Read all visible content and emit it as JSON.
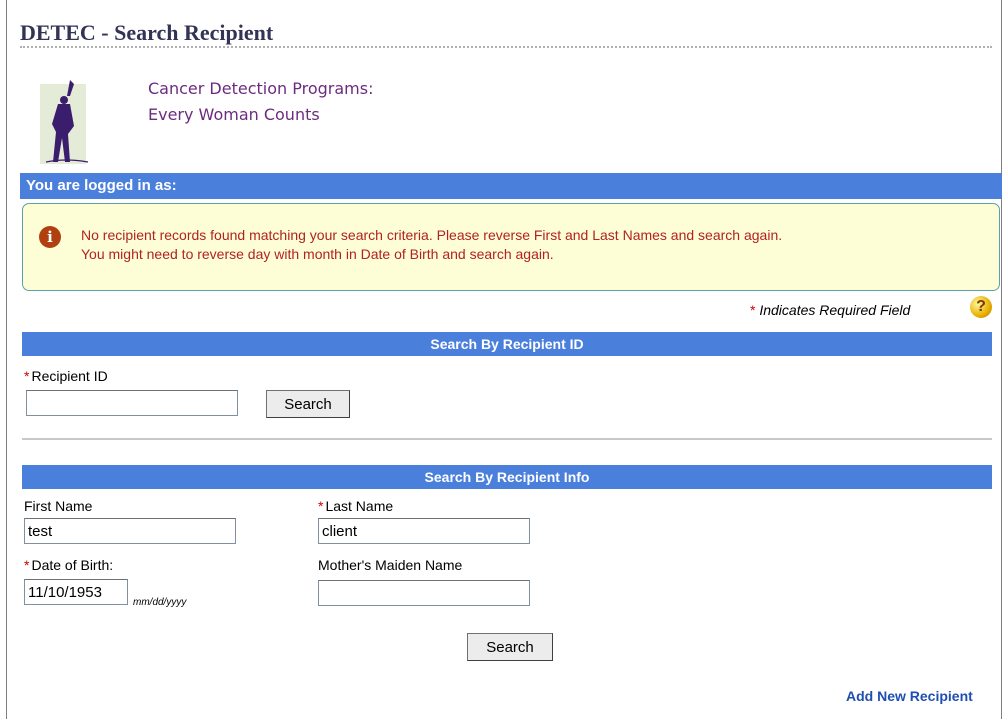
{
  "page": {
    "title": "DETEC - Search Recipient"
  },
  "branding": {
    "line1": "Cancer Detection Programs:",
    "line2": "Every Woman Counts"
  },
  "login_bar": {
    "text": "You are logged in as:"
  },
  "message": {
    "icon": "info-icon",
    "line1": "No recipient records found matching your search criteria. Please reverse First and Last Names and search again.",
    "line2": "You might need to reverse day with month in Date of Birth and search again."
  },
  "required_note": {
    "star": "*",
    "text": "Indicates Required Field",
    "help_icon": "?"
  },
  "search_by_id": {
    "header": "Search By Recipient ID",
    "recipient_id_label": "Recipient ID",
    "recipient_id_value": "",
    "search_button": "Search"
  },
  "search_by_info": {
    "header": "Search By Recipient Info",
    "first_name_label": "First Name",
    "first_name_value": "test",
    "last_name_label": "Last Name",
    "last_name_value": "client",
    "dob_label": "Date of Birth:",
    "dob_value": "11/10/1953",
    "dob_hint": "mm/dd/yyyy",
    "maiden_name_label": "Mother's Maiden Name",
    "maiden_name_value": "",
    "search_button": "Search"
  },
  "footer": {
    "add_new_link": "Add New Recipient"
  },
  "colors": {
    "bar_blue": "#4a7fdc",
    "message_red": "#b22222",
    "brand_purple": "#6d2b80",
    "required_star": "#d00000",
    "link_blue": "#1f4fb0"
  }
}
